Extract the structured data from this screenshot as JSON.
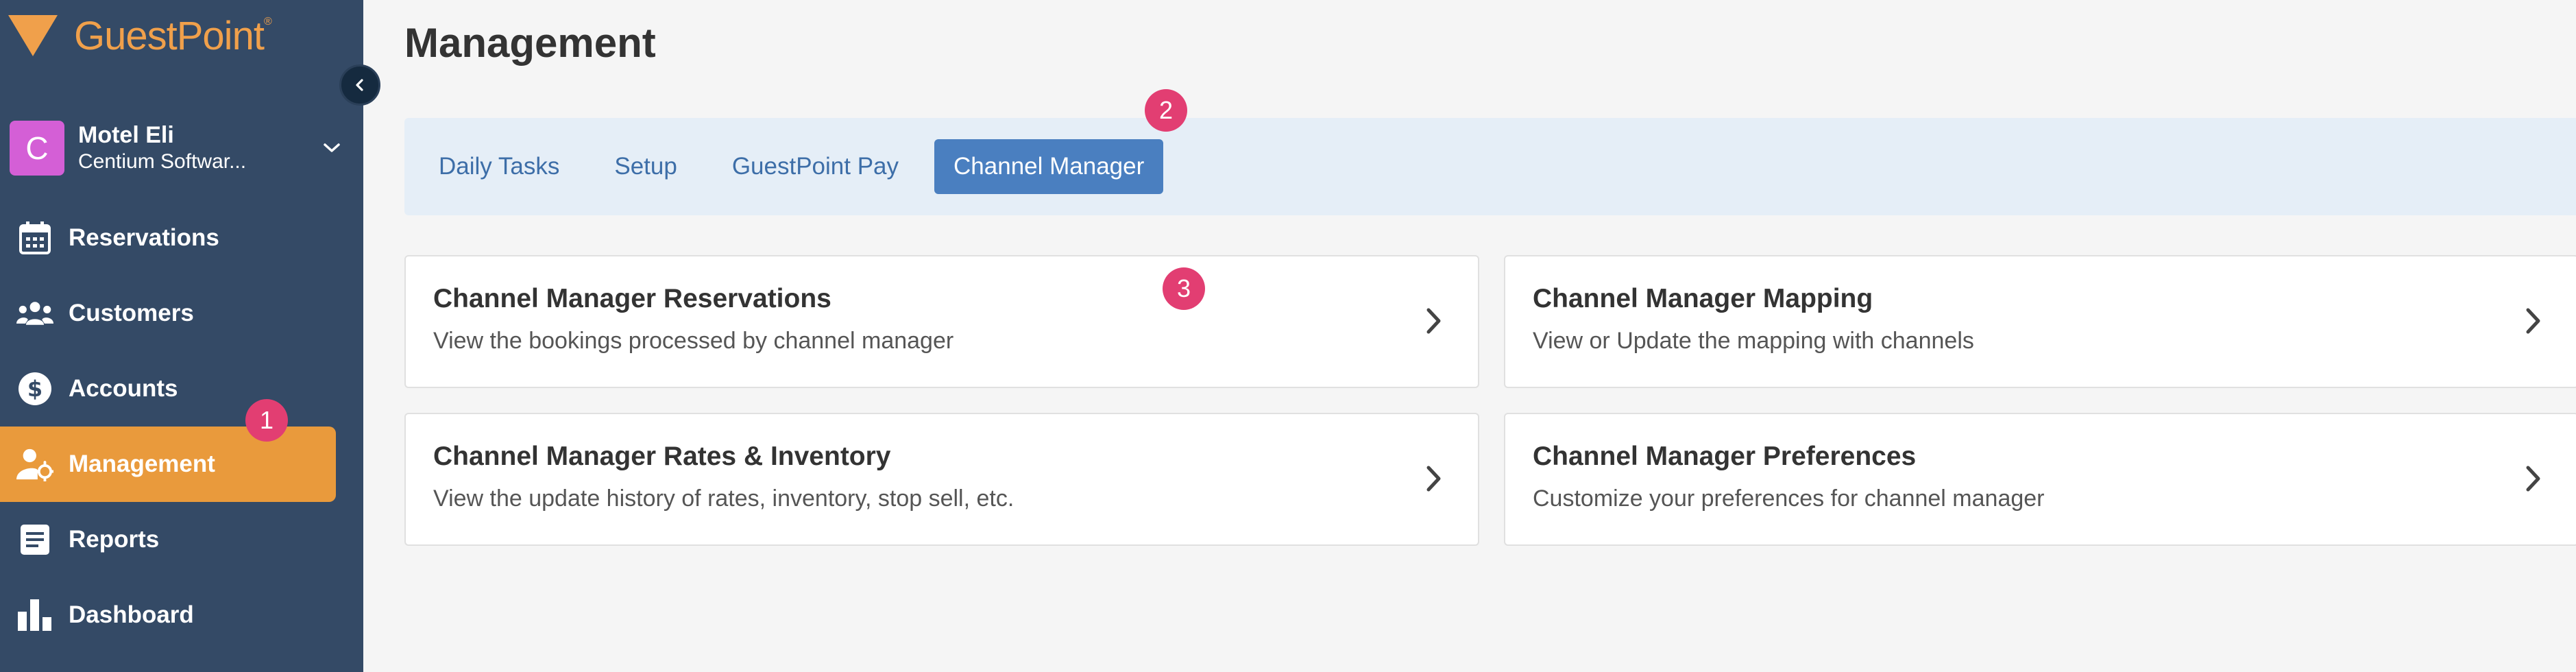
{
  "app": {
    "logo_text": "GuestPoint",
    "logo_mark": "®"
  },
  "property": {
    "avatar_letter": "C",
    "name": "Motel Eli",
    "company": "Centium Softwar..."
  },
  "sidebar": {
    "items": [
      {
        "label": "Reservations",
        "icon": "calendar-icon"
      },
      {
        "label": "Customers",
        "icon": "users-icon"
      },
      {
        "label": "Accounts",
        "icon": "dollar-icon"
      },
      {
        "label": "Management",
        "icon": "user-gear-icon",
        "active": true
      },
      {
        "label": "Reports",
        "icon": "document-icon"
      },
      {
        "label": "Dashboard",
        "icon": "bar-chart-icon"
      }
    ]
  },
  "badges": [
    "1",
    "2",
    "3"
  ],
  "main": {
    "title": "Management",
    "tabs": [
      {
        "label": "Daily Tasks"
      },
      {
        "label": "Setup"
      },
      {
        "label": "GuestPoint Pay"
      },
      {
        "label": "Channel Manager",
        "active": true
      }
    ],
    "cards": [
      {
        "title": "Channel Manager Reservations",
        "description": "View the bookings processed by channel manager"
      },
      {
        "title": "Channel Manager Mapping",
        "description": "View or Update the mapping with channels"
      },
      {
        "title": "Channel Manager Rates & Inventory",
        "description": "View the update history of rates, inventory, stop sell, etc."
      },
      {
        "title": "Channel Manager Preferences",
        "description": "Customize your preferences for channel manager"
      }
    ]
  },
  "colors": {
    "sidebar_bg": "#344a66",
    "accent_orange": "#e99a3c",
    "tab_active": "#4a7fc0",
    "badge": "#e23e72",
    "avatar": "#d45fd6"
  }
}
